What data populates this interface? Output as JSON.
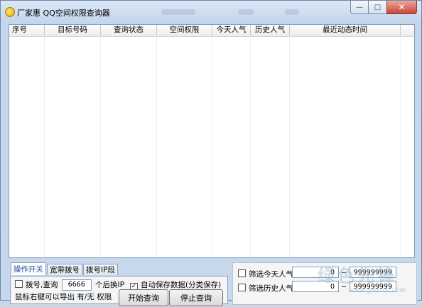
{
  "window": {
    "title": "厂家惠 QQ空间权限查询器",
    "controls": {
      "minimize": "—",
      "maximize": "□",
      "close": "✕"
    }
  },
  "list": {
    "columns": [
      "序号",
      "目标号码",
      "查询状态",
      "空间权限",
      "今天人气",
      "历史人气",
      "最近动态时间"
    ],
    "rows": []
  },
  "tabs": [
    {
      "label": "操作开关",
      "active": true
    },
    {
      "label": "宽带拨号",
      "active": false
    },
    {
      "label": "拨号IP段",
      "active": false
    }
  ],
  "panel": {
    "dial_label_before": "拨号,查询",
    "dial_count": "6666",
    "dial_label_after": "个后换IP",
    "autosave_label": "自动保存数据(分类保存)",
    "autosave_checked": true,
    "hint": "鼠标右键可以导出 有/无 权限",
    "start_button": "开始查询",
    "stop_button": "停止查询"
  },
  "filters": {
    "today": {
      "label": "筛选今天人气",
      "min": "0",
      "max": "999999999"
    },
    "history": {
      "label": "筛选历史人气",
      "min": "0",
      "max": "999999999"
    }
  },
  "watermark": {
    "text": "绿色先锋",
    "url": "www.greenxf.com"
  }
}
